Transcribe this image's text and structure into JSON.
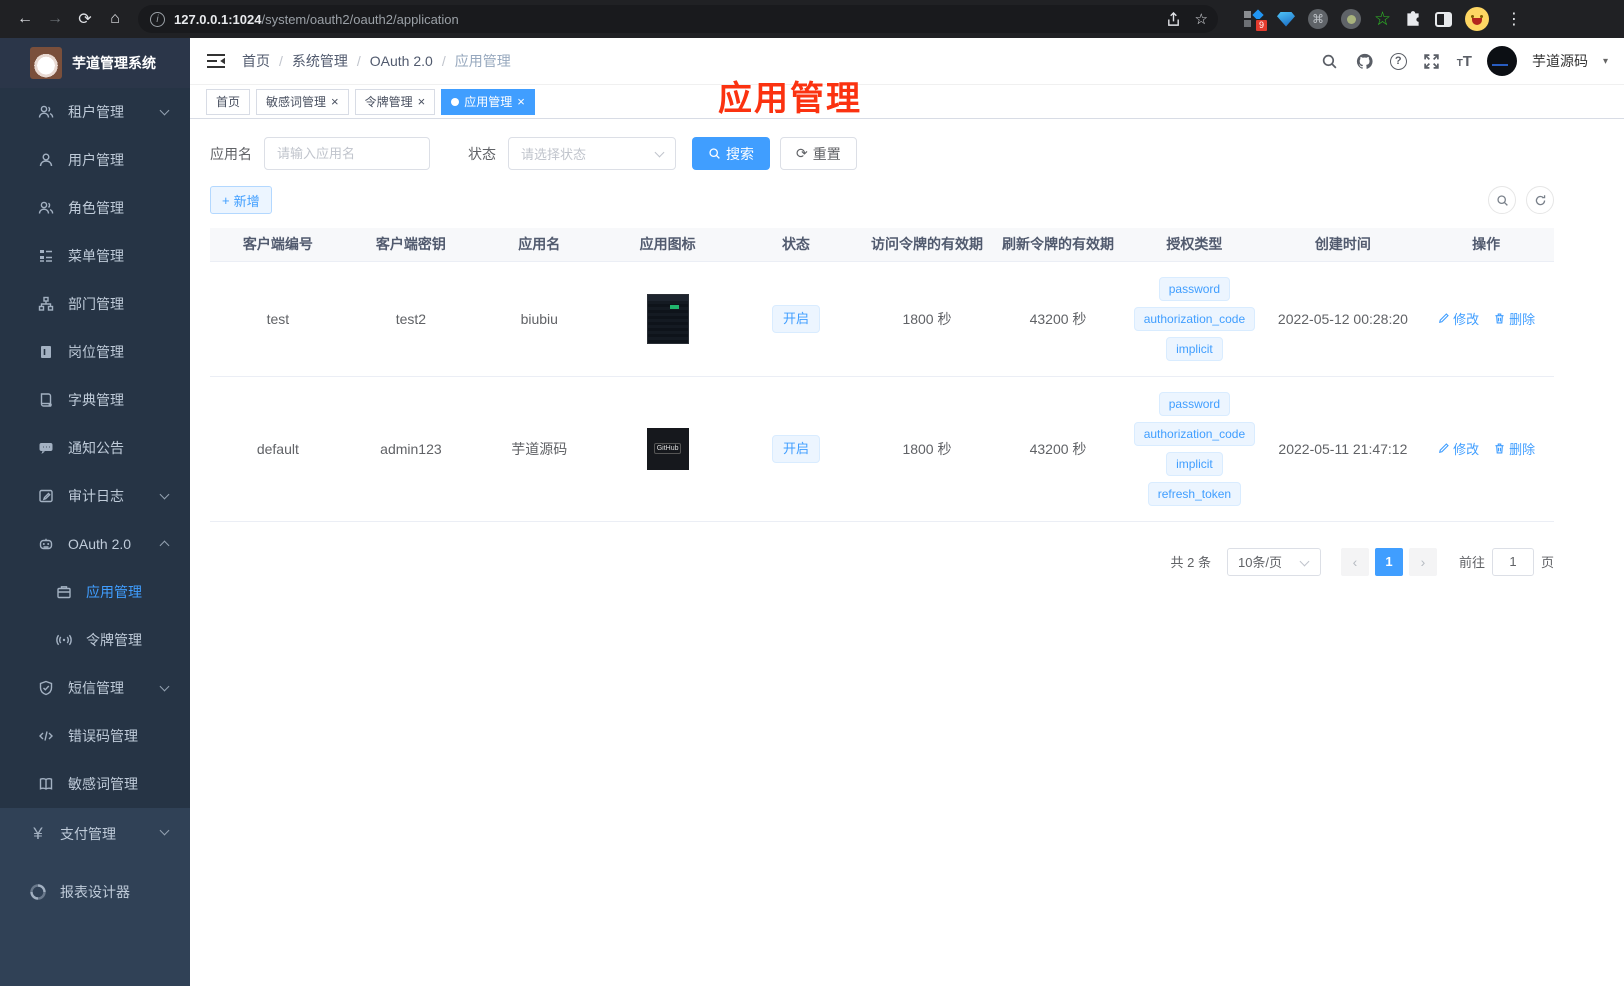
{
  "colors": {
    "accent": "#409eff",
    "annotation": "#fb3210",
    "sidebar_dark": "#263445",
    "sidebar_light": "#304156"
  },
  "glyphs": {
    "back": "←",
    "forward": "→",
    "reload": "⟳",
    "home": "⌂",
    "info": "i",
    "star": "☆",
    "cmd": "⌘",
    "green_star": "☆",
    "kebab": "⋮",
    "caret": "▾",
    "close": "×",
    "plus": "+",
    "reset_circ": "⟳",
    "prev": "‹",
    "next": "›",
    "yen": "¥",
    "t_small": "T",
    "t_large": "T"
  },
  "browser": {
    "url_host": "127.0.0.1:1024",
    "url_path": "/system/oauth2/oauth2/application",
    "ext_badge": "9"
  },
  "sidebar": {
    "logo_title": "芋道管理系统",
    "menu": [
      {
        "label": "租户管理"
      },
      {
        "label": "用户管理"
      },
      {
        "label": "角色管理"
      },
      {
        "label": "菜单管理"
      },
      {
        "label": "部门管理"
      },
      {
        "label": "岗位管理"
      },
      {
        "label": "字典管理"
      },
      {
        "label": "通知公告"
      },
      {
        "label": "审计日志"
      },
      {
        "label": "OAuth 2.0"
      },
      {
        "label": "应用管理"
      },
      {
        "label": "令牌管理"
      },
      {
        "label": "短信管理"
      },
      {
        "label": "错误码管理"
      },
      {
        "label": "敏感词管理"
      },
      {
        "label": "支付管理"
      },
      {
        "label": "报表设计器"
      }
    ]
  },
  "navbar": {
    "breadcrumb": [
      "首页",
      "系统管理",
      "OAuth 2.0",
      "应用管理"
    ],
    "separator": "/",
    "username": "芋道源码"
  },
  "annotation": {
    "text": "应用管理"
  },
  "tabs": [
    {
      "label": "首页"
    },
    {
      "label": "敏感词管理"
    },
    {
      "label": "令牌管理"
    },
    {
      "label": "应用管理"
    }
  ],
  "filters": {
    "name_label": "应用名",
    "name_placeholder": "请输入应用名",
    "status_label": "状态",
    "status_placeholder": "请选择状态",
    "search_label": "搜索",
    "reset_label": "重置"
  },
  "toolbar": {
    "add_label": "新增"
  },
  "table": {
    "headers": [
      "客户端编号",
      "客户端密钥",
      "应用名",
      "应用图标",
      "状态",
      "访问令牌的有效期",
      "刷新令牌的有效期",
      "授权类型",
      "创建时间",
      "操作"
    ],
    "rows": [
      {
        "client_id": "test",
        "client_secret": "test2",
        "app_name": "biubiu",
        "status": "开启",
        "access_ttl": "1800 秒",
        "refresh_ttl": "43200 秒",
        "grant_types": [
          "password",
          "authorization_code",
          "implicit"
        ],
        "created_at": "2022-05-12 00:28:20",
        "edit_label": "修改",
        "delete_label": "删除"
      },
      {
        "client_id": "default",
        "client_secret": "admin123",
        "app_name": "芋道源码",
        "status": "开启",
        "access_ttl": "1800 秒",
        "refresh_ttl": "43200 秒",
        "grant_types": [
          "password",
          "authorization_code",
          "implicit",
          "refresh_token"
        ],
        "icon_label": "GitHub",
        "created_at": "2022-05-11 21:47:12",
        "edit_label": "修改",
        "delete_label": "删除"
      }
    ]
  },
  "pagination": {
    "total": "共 2 条",
    "page_size": "10条/页",
    "page": "1",
    "goto_label": "前往",
    "goto_value": "1",
    "unit_label": "页"
  }
}
